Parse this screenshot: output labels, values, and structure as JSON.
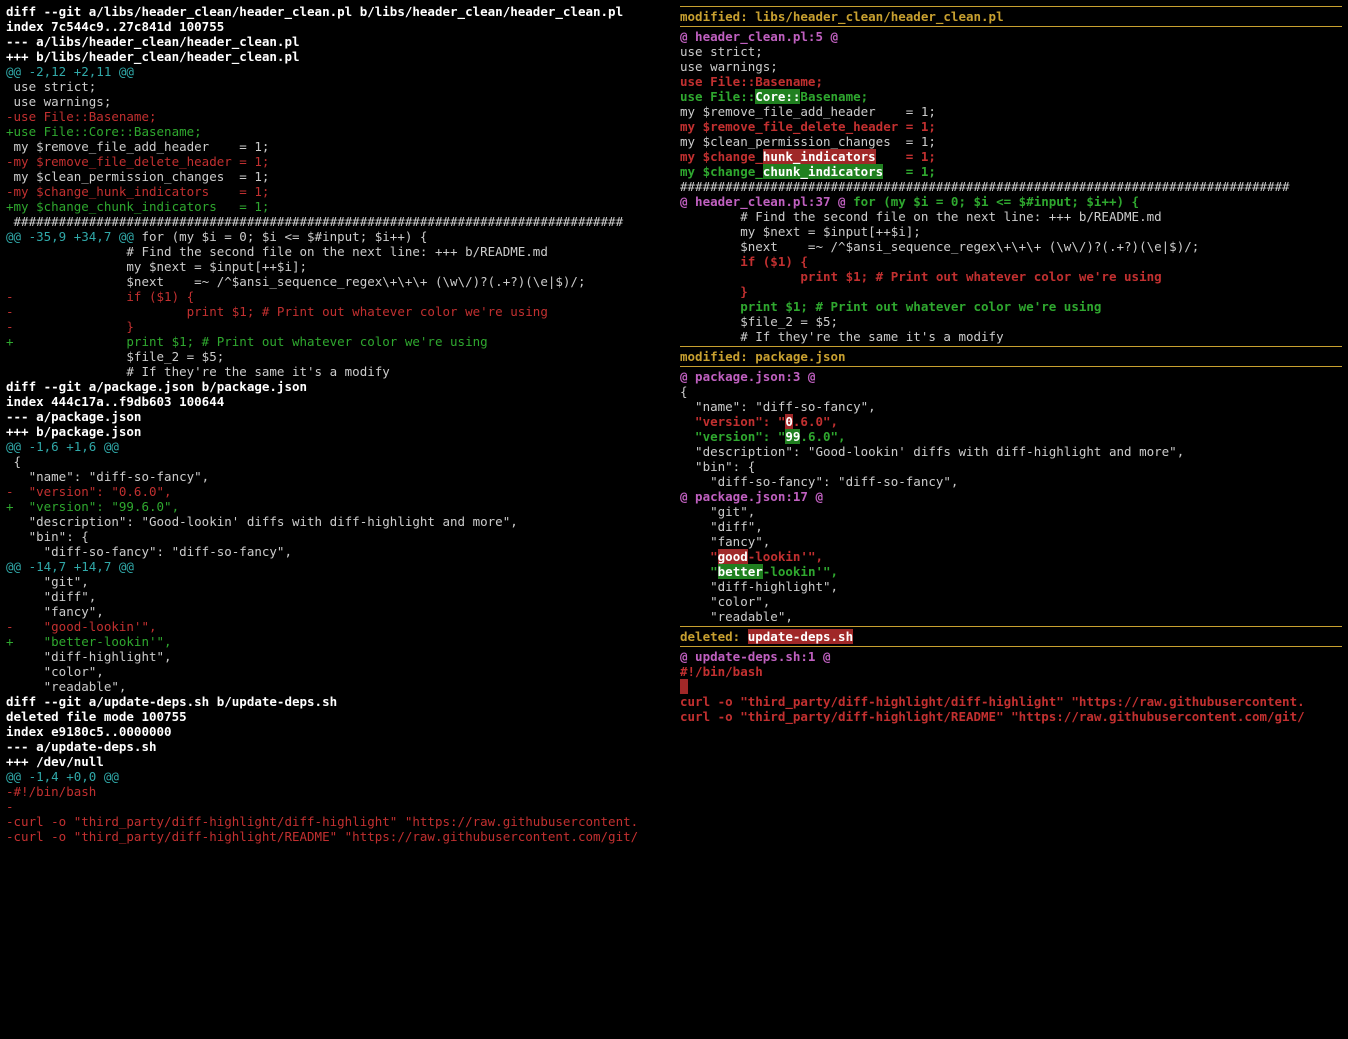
{
  "left": [
    {
      "cls": "bold wht",
      "t": "diff --git a/libs/header_clean/header_clean.pl b/libs/header_clean/header_clean.pl"
    },
    {
      "cls": "bold wht",
      "t": "index 7c544c9..27c841d 100755"
    },
    {
      "cls": "bold wht",
      "t": "--- a/libs/header_clean/header_clean.pl"
    },
    {
      "cls": "bold wht",
      "t": "+++ b/libs/header_clean/header_clean.pl"
    },
    {
      "cls": "cyan",
      "t": "@@ -2,12 +2,11 @@"
    },
    {
      "cls": "plain",
      "t": ""
    },
    {
      "cls": "plain",
      "t": " use strict;"
    },
    {
      "cls": "plain",
      "t": " use warnings;"
    },
    {
      "cls": "red",
      "t": "-use File::Basename;"
    },
    {
      "cls": "grn",
      "t": "+use File::Core::Basename;"
    },
    {
      "cls": "plain",
      "t": ""
    },
    {
      "cls": "plain",
      "t": " my $remove_file_add_header    = 1;"
    },
    {
      "cls": "red",
      "t": "-my $remove_file_delete_header = 1;"
    },
    {
      "cls": "plain",
      "t": " my $clean_permission_changes  = 1;"
    },
    {
      "cls": "red",
      "t": "-my $change_hunk_indicators    = 1;"
    },
    {
      "cls": "grn",
      "t": "+my $change_chunk_indicators   = 1;"
    },
    {
      "cls": "plain",
      "t": ""
    },
    {
      "cls": "plain",
      "t": " #################################################################################"
    },
    {
      "cls": "plain",
      "t": ""
    },
    {
      "segments": [
        {
          "cls": "cyan",
          "t": "@@ -35,9 +34,7 @@"
        },
        {
          "cls": "plain",
          "t": " for (my $i = 0; $i <= $#input; $i++) {"
        }
      ]
    },
    {
      "cls": "plain",
      "t": "                # Find the second file on the next line: +++ b/README.md"
    },
    {
      "cls": "plain",
      "t": "                my $next = $input[++$i];"
    },
    {
      "cls": "plain",
      "t": "                $next    =~ /^$ansi_sequence_regex\\+\\+\\+ (\\w\\/)?(.+?)(\\e|$)/;"
    },
    {
      "cls": "red",
      "t": "-               if ($1) {"
    },
    {
      "cls": "red",
      "t": "-                       print $1; # Print out whatever color we're using"
    },
    {
      "cls": "red",
      "t": "-               }"
    },
    {
      "cls": "grn",
      "t": "+               print $1; # Print out whatever color we're using"
    },
    {
      "cls": "plain",
      "t": "                $file_2 = $5;"
    },
    {
      "cls": "plain",
      "t": ""
    },
    {
      "cls": "plain",
      "t": "                # If they're the same it's a modify"
    },
    {
      "cls": "bold wht",
      "t": "diff --git a/package.json b/package.json"
    },
    {
      "cls": "bold wht",
      "t": "index 444c17a..f9db603 100644"
    },
    {
      "cls": "bold wht",
      "t": "--- a/package.json"
    },
    {
      "cls": "bold wht",
      "t": "+++ b/package.json"
    },
    {
      "cls": "cyan",
      "t": "@@ -1,6 +1,6 @@"
    },
    {
      "cls": "plain",
      "t": " {"
    },
    {
      "cls": "plain",
      "t": "   \"name\": \"diff-so-fancy\","
    },
    {
      "cls": "red",
      "t": "-  \"version\": \"0.6.0\","
    },
    {
      "cls": "grn",
      "t": "+  \"version\": \"99.6.0\","
    },
    {
      "cls": "plain",
      "t": "   \"description\": \"Good-lookin' diffs with diff-highlight and more\","
    },
    {
      "cls": "plain",
      "t": "   \"bin\": {"
    },
    {
      "cls": "plain",
      "t": "     \"diff-so-fancy\": \"diff-so-fancy\","
    },
    {
      "cls": "cyan",
      "t": "@@ -14,7 +14,7 @@"
    },
    {
      "cls": "plain",
      "t": "     \"git\","
    },
    {
      "cls": "plain",
      "t": "     \"diff\","
    },
    {
      "cls": "plain",
      "t": "     \"fancy\","
    },
    {
      "cls": "red",
      "t": "-    \"good-lookin'\","
    },
    {
      "cls": "grn",
      "t": "+    \"better-lookin'\","
    },
    {
      "cls": "plain",
      "t": "     \"diff-highlight\","
    },
    {
      "cls": "plain",
      "t": "     \"color\","
    },
    {
      "cls": "plain",
      "t": "     \"readable\","
    },
    {
      "cls": "bold wht",
      "t": "diff --git a/update-deps.sh b/update-deps.sh"
    },
    {
      "cls": "bold wht",
      "t": "deleted file mode 100755"
    },
    {
      "cls": "bold wht",
      "t": "index e9180c5..0000000"
    },
    {
      "cls": "bold wht",
      "t": "--- a/update-deps.sh"
    },
    {
      "cls": "bold wht",
      "t": "+++ /dev/null"
    },
    {
      "cls": "cyan",
      "t": "@@ -1,4 +0,0 @@"
    },
    {
      "cls": "red",
      "t": "-#!/bin/bash"
    },
    {
      "cls": "red",
      "t": "-"
    },
    {
      "cls": "red",
      "t": "-curl -o \"third_party/diff-highlight/diff-highlight\" \"https://raw.githubusercontent."
    },
    {
      "cls": "red",
      "t": "-curl -o \"third_party/diff-highlight/README\" \"https://raw.githubusercontent.com/git/"
    }
  ],
  "right": [
    {
      "rule": true
    },
    {
      "cls": "bold yel",
      "t": "modified: libs/header_clean/header_clean.pl"
    },
    {
      "rule": true
    },
    {
      "cls": "bold mag",
      "t": "@ header_clean.pl:5 @"
    },
    {
      "cls": "plain",
      "t": ""
    },
    {
      "cls": "plain",
      "t": "use strict;"
    },
    {
      "cls": "plain",
      "t": "use warnings;"
    },
    {
      "cls": "bold red",
      "t": "use File::Basename;"
    },
    {
      "segments": [
        {
          "cls": "bold grn",
          "t": "use File::"
        },
        {
          "cls": "hl-grn-bg bold",
          "t": "Core::"
        },
        {
          "cls": "bold grn",
          "t": "Basename;"
        }
      ]
    },
    {
      "cls": "plain",
      "t": ""
    },
    {
      "cls": "plain",
      "t": "my $remove_file_add_header    = 1;"
    },
    {
      "cls": "bold red",
      "t": "my $remove_file_delete_header = 1;"
    },
    {
      "cls": "plain",
      "t": "my $clean_permission_changes  = 1;"
    },
    {
      "segments": [
        {
          "cls": "bold red",
          "t": "my $change_"
        },
        {
          "cls": "hl-red-bg bold",
          "t": "hunk_indicators"
        },
        {
          "cls": "bold red",
          "t": "    = 1;"
        }
      ]
    },
    {
      "segments": [
        {
          "cls": "bold grn",
          "t": "my $change_"
        },
        {
          "cls": "hl-grn-bg bold",
          "t": "chunk_indicators"
        },
        {
          "cls": "bold grn",
          "t": "   = 1;"
        }
      ]
    },
    {
      "cls": "plain",
      "t": ""
    },
    {
      "cls": "plain",
      "t": "#################################################################################"
    },
    {
      "cls": "plain",
      "t": ""
    },
    {
      "segments": [
        {
          "cls": "bold mag",
          "t": "@ header_clean.pl:37 @ "
        },
        {
          "cls": "bold grn",
          "t": "for (my $i = 0; $i <= $#input; $i++) {"
        }
      ]
    },
    {
      "cls": "plain",
      "t": "        # Find the second file on the next line: +++ b/README.md"
    },
    {
      "cls": "plain",
      "t": "        my $next = $input[++$i];"
    },
    {
      "cls": "plain",
      "t": "        $next    =~ /^$ansi_sequence_regex\\+\\+\\+ (\\w\\/)?(.+?)(\\e|$)/;"
    },
    {
      "cls": "bold red",
      "t": "        if ($1) {"
    },
    {
      "cls": "bold red",
      "t": "                print $1; # Print out whatever color we're using"
    },
    {
      "cls": "bold red",
      "t": "        }"
    },
    {
      "cls": "bold grn",
      "t": "        print $1; # Print out whatever color we're using"
    },
    {
      "cls": "plain",
      "t": "        $file_2 = $5;"
    },
    {
      "cls": "plain",
      "t": ""
    },
    {
      "cls": "plain",
      "t": "        # If they're the same it's a modify"
    },
    {
      "rule": true
    },
    {
      "cls": "bold yel",
      "t": "modified: package.json"
    },
    {
      "rule": true
    },
    {
      "cls": "bold mag",
      "t": "@ package.json:3 @"
    },
    {
      "cls": "plain",
      "t": "{"
    },
    {
      "cls": "plain",
      "t": "  \"name\": \"diff-so-fancy\","
    },
    {
      "segments": [
        {
          "cls": "bold red",
          "t": "  \"version\": \""
        },
        {
          "cls": "hl-red-bg bold",
          "t": "0"
        },
        {
          "cls": "bold red",
          "t": ".6.0\","
        }
      ]
    },
    {
      "segments": [
        {
          "cls": "bold grn",
          "t": "  \"version\": \""
        },
        {
          "cls": "hl-grn-bg bold",
          "t": "99"
        },
        {
          "cls": "bold grn",
          "t": ".6.0\","
        }
      ]
    },
    {
      "cls": "plain",
      "t": "  \"description\": \"Good-lookin' diffs with diff-highlight and more\","
    },
    {
      "cls": "plain",
      "t": "  \"bin\": {"
    },
    {
      "cls": "plain",
      "t": "    \"diff-so-fancy\": \"diff-so-fancy\","
    },
    {
      "cls": "bold mag",
      "t": "@ package.json:17 @"
    },
    {
      "cls": "plain",
      "t": "    \"git\","
    },
    {
      "cls": "plain",
      "t": "    \"diff\","
    },
    {
      "cls": "plain",
      "t": "    \"fancy\","
    },
    {
      "segments": [
        {
          "cls": "bold red",
          "t": "    \""
        },
        {
          "cls": "hl-red-bg bold",
          "t": "good"
        },
        {
          "cls": "bold red",
          "t": "-lookin'\","
        }
      ]
    },
    {
      "segments": [
        {
          "cls": "bold grn",
          "t": "    \""
        },
        {
          "cls": "hl-grn-bg bold",
          "t": "better"
        },
        {
          "cls": "bold grn",
          "t": "-lookin'\","
        }
      ]
    },
    {
      "cls": "plain",
      "t": "    \"diff-highlight\","
    },
    {
      "cls": "plain",
      "t": "    \"color\","
    },
    {
      "cls": "plain",
      "t": "    \"readable\","
    },
    {
      "rule": true
    },
    {
      "segments": [
        {
          "cls": "bold yel",
          "t": "deleted: "
        },
        {
          "cls": "hl-red-bg bold",
          "t": "update-deps.sh"
        }
      ]
    },
    {
      "rule": true
    },
    {
      "cls": "bold mag",
      "t": "@ update-deps.sh:1 @"
    },
    {
      "cls": "bold red",
      "t": "#!/bin/bash"
    },
    {
      "segments": [
        {
          "cls": "hl-red-solid",
          "t": " "
        }
      ]
    },
    {
      "cls": "bold red",
      "t": "curl -o \"third_party/diff-highlight/diff-highlight\" \"https://raw.githubusercontent."
    },
    {
      "cls": "bold red",
      "t": "curl -o \"third_party/diff-highlight/README\" \"https://raw.githubusercontent.com/git/"
    }
  ]
}
